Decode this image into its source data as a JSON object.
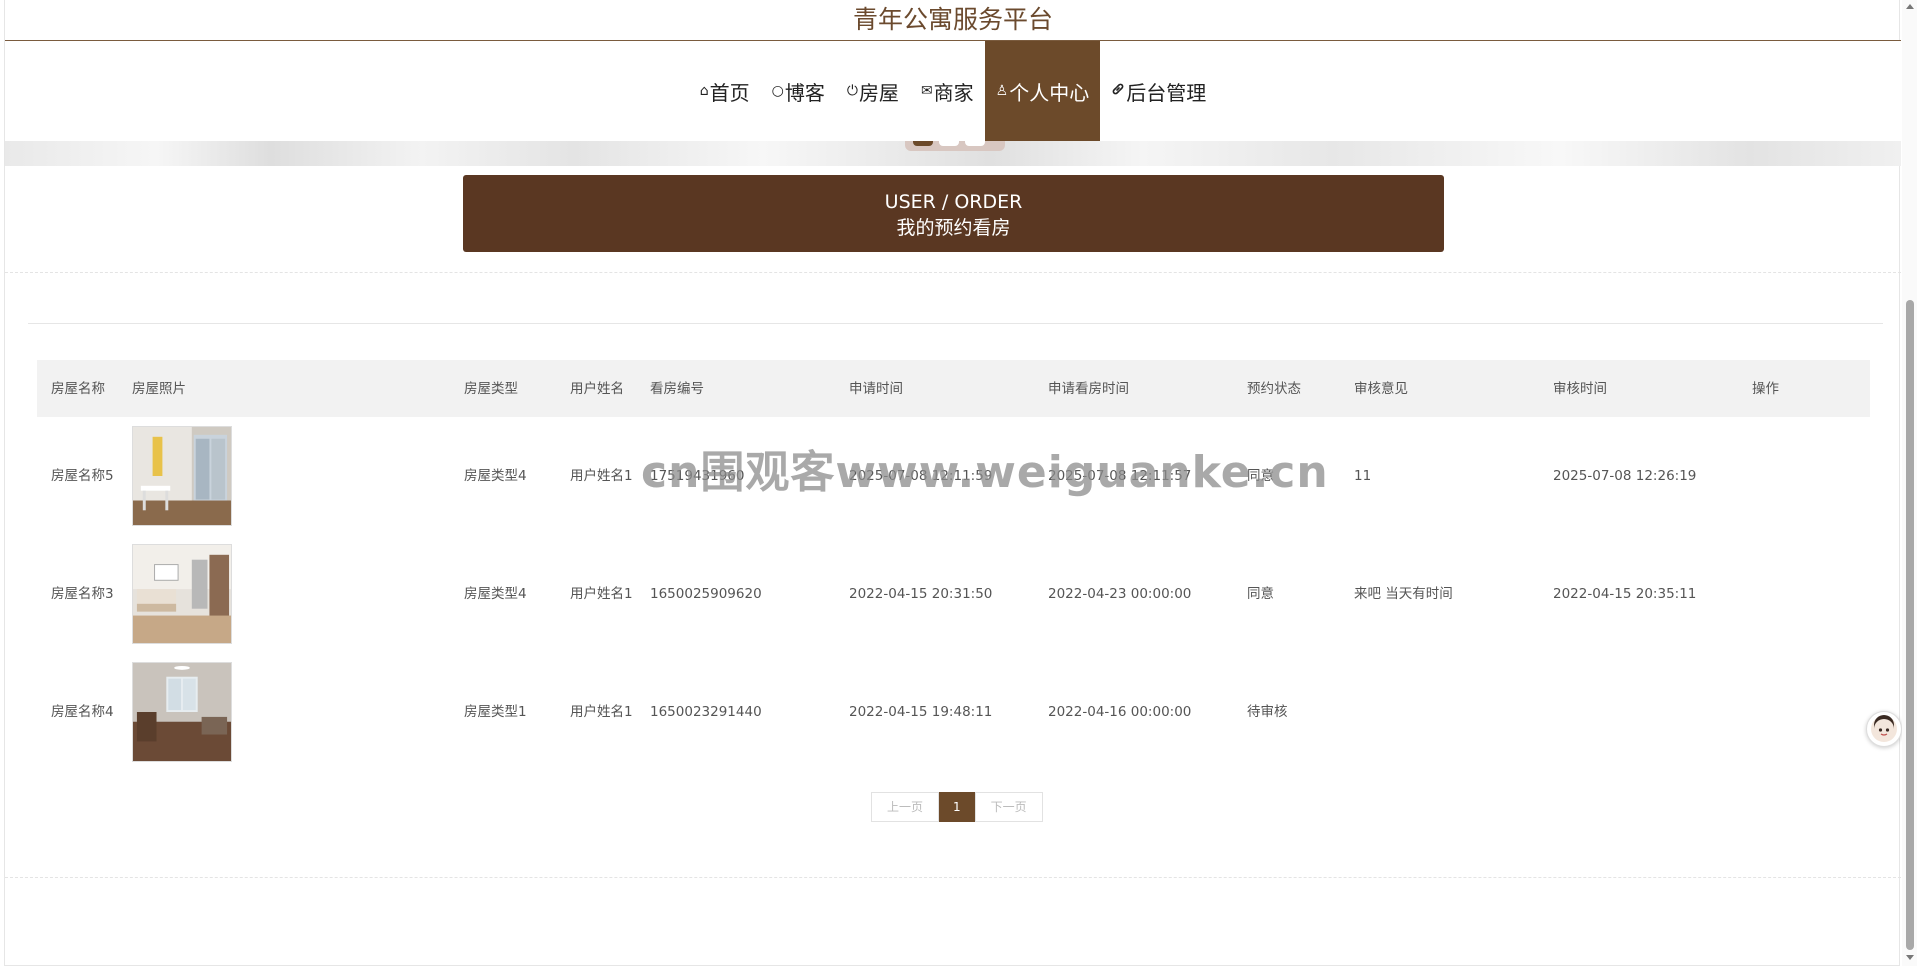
{
  "site": {
    "title": "青年公寓服务平台"
  },
  "nav": {
    "items": [
      {
        "icon": "home-icon",
        "glyph": "⌂",
        "label": "首页"
      },
      {
        "icon": "circle-icon",
        "glyph": "○",
        "label": "博客"
      },
      {
        "icon": "power-icon",
        "glyph": "⏻",
        "label": "房屋"
      },
      {
        "icon": "mail-icon",
        "glyph": "✉",
        "label": "商家"
      },
      {
        "icon": "user-icon",
        "glyph": "♙",
        "label": "个人中心",
        "active": true
      },
      {
        "icon": "link-icon",
        "glyph": "🔗",
        "label": "后台管理"
      }
    ]
  },
  "header": {
    "en": "USER / ORDER",
    "cn": "我的预约看房"
  },
  "table": {
    "columns": [
      "房屋名称",
      "房屋照片",
      "房屋类型",
      "用户姓名",
      "看房编号",
      "申请时间",
      "申请看房时间",
      "预约状态",
      "审核意见",
      "审核时间",
      "操作"
    ],
    "rows": [
      {
        "name": "房屋名称5",
        "photo": "room-photo-1",
        "type": "房屋类型4",
        "user": "用户姓名1",
        "code": "17519431960",
        "apply_time": "2025-07-08 12:11:59",
        "visit_time": "2025-07-08 12:11:57",
        "status": "同意",
        "opinion": "11",
        "review_time": "2025-07-08 12:26:19",
        "action": ""
      },
      {
        "name": "房屋名称3",
        "photo": "room-photo-2",
        "type": "房屋类型4",
        "user": "用户姓名1",
        "code": "1650025909620",
        "apply_time": "2022-04-15 20:31:50",
        "visit_time": "2022-04-23 00:00:00",
        "status": "同意",
        "opinion": "来吧 当天有时间",
        "review_time": "2022-04-15 20:35:11",
        "action": ""
      },
      {
        "name": "房屋名称4",
        "photo": "room-photo-3",
        "type": "房屋类型1",
        "user": "用户姓名1",
        "code": "1650023291440",
        "apply_time": "2022-04-15 19:48:11",
        "visit_time": "2022-04-16 00:00:00",
        "status": "待审核",
        "opinion": "",
        "review_time": "",
        "action": ""
      }
    ]
  },
  "pager": {
    "prev": "上一页",
    "current": "1",
    "next": "下一页"
  },
  "watermark": "cn围观客www.weiguanke.cn",
  "colors": {
    "brand": "#6c4a2a",
    "header_box": "#5a3722",
    "title": "#6b4a2e"
  }
}
